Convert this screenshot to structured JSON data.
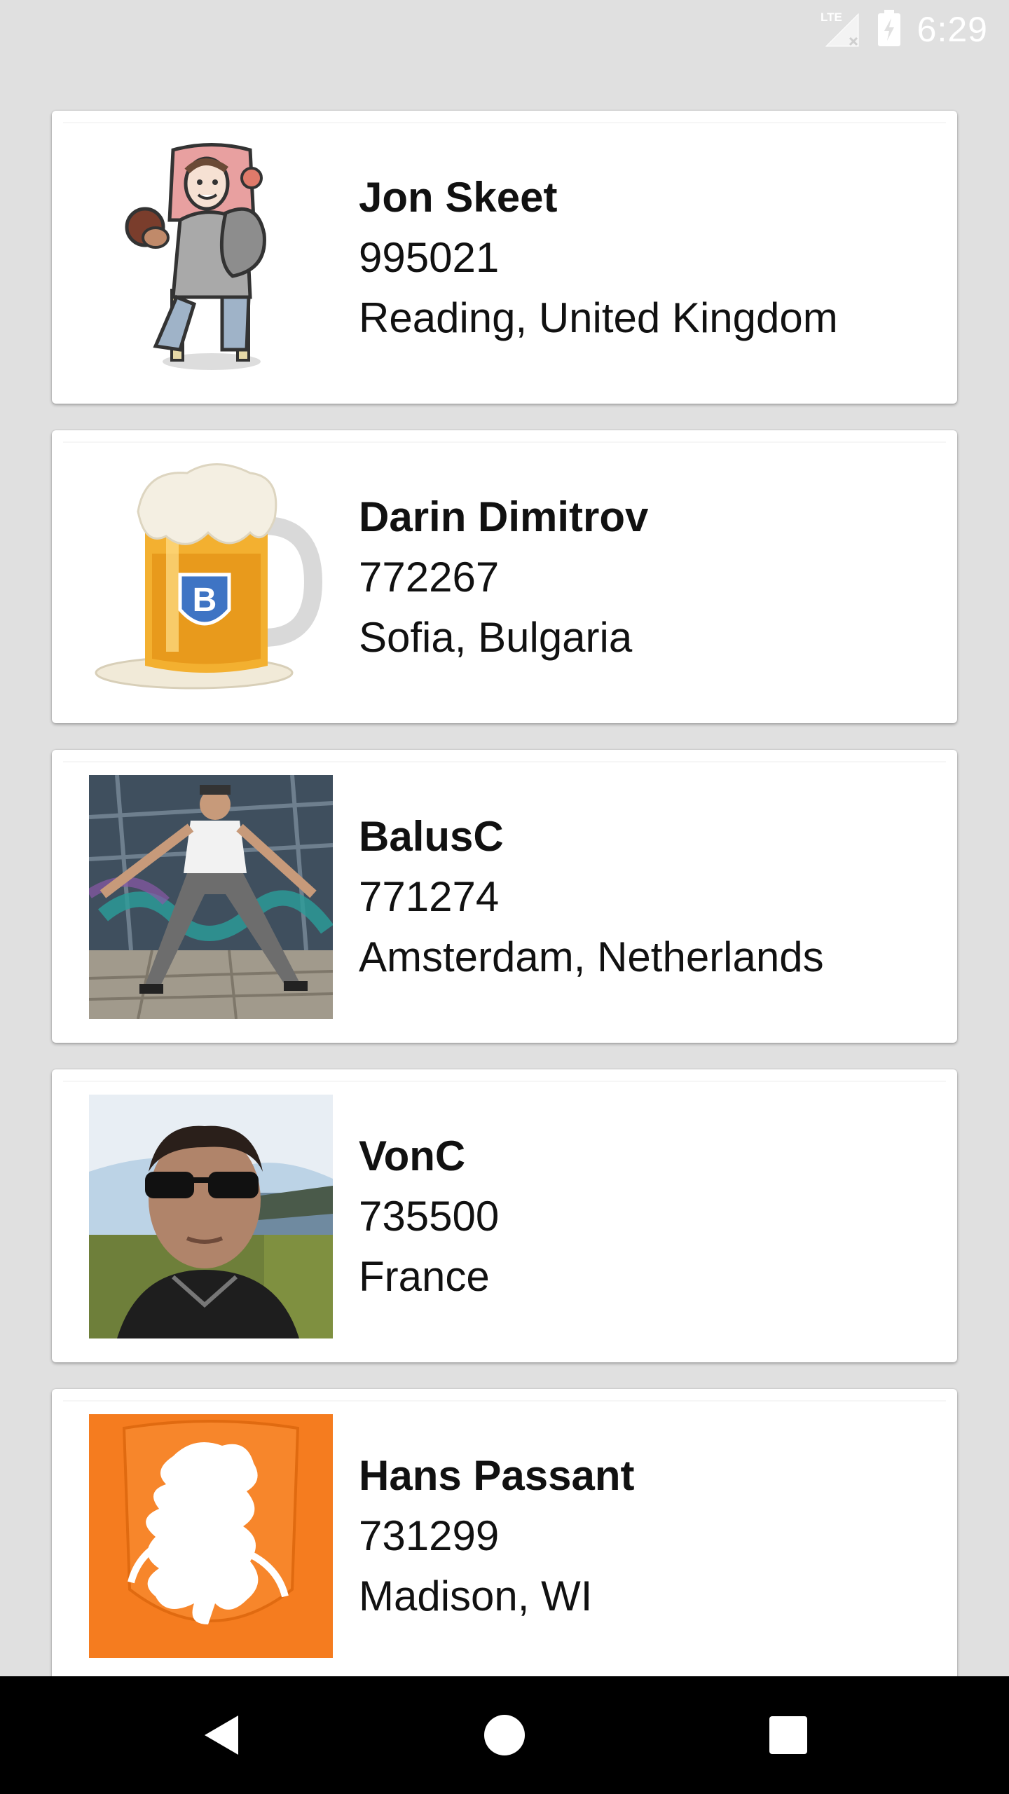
{
  "status_bar": {
    "network": "LTE",
    "time": "6:29",
    "icons": [
      "lte-signal-icon",
      "battery-charging-icon"
    ]
  },
  "users": [
    {
      "name": "Jon Skeet",
      "reputation": "995021",
      "location": "Reading, United Kingdom",
      "avatar": "cartoon-avatar"
    },
    {
      "name": "Darin Dimitrov",
      "reputation": "772267",
      "location": "Sofia, Bulgaria",
      "avatar": "beer-mug-avatar"
    },
    {
      "name": "BalusC",
      "reputation": "771274",
      "location": "Amsterdam, Netherlands",
      "avatar": "photo-avatar"
    },
    {
      "name": "VonC",
      "reputation": "735500",
      "location": "France",
      "avatar": "photo-avatar"
    },
    {
      "name": "Hans Passant",
      "reputation": "731299",
      "location": "Madison, WI",
      "avatar": "lion-crest-avatar"
    }
  ],
  "nav_bar": {
    "buttons": [
      "back-icon",
      "home-icon",
      "recents-icon"
    ]
  },
  "colors": {
    "background": "#e0e0e0",
    "card": "#ffffff",
    "text": "#111111",
    "nav_bar": "#000000",
    "orange": "#f57c1f"
  }
}
